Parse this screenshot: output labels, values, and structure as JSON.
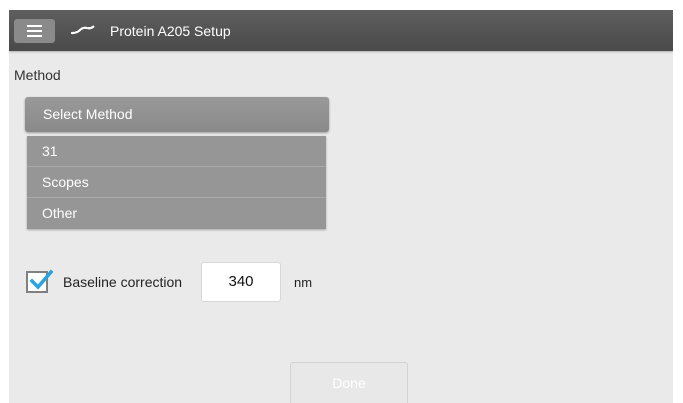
{
  "header": {
    "title": "Protein A205 Setup",
    "menu_icon": "hamburger-menu-icon",
    "logo_icon": "spectrum-wave-icon"
  },
  "method": {
    "label": "Method",
    "select_value": "Select Method",
    "options": [
      "31",
      "Scopes",
      "Other"
    ]
  },
  "baseline": {
    "checked": true,
    "label": "Baseline correction",
    "value": "340",
    "unit": "nm"
  },
  "footer": {
    "done_label": "Done",
    "done_enabled": false
  },
  "colors": {
    "titlebar": "#555555",
    "background": "#eaeaea",
    "select": "#8f8f8f",
    "checkbox_check": "#29a3e0"
  }
}
